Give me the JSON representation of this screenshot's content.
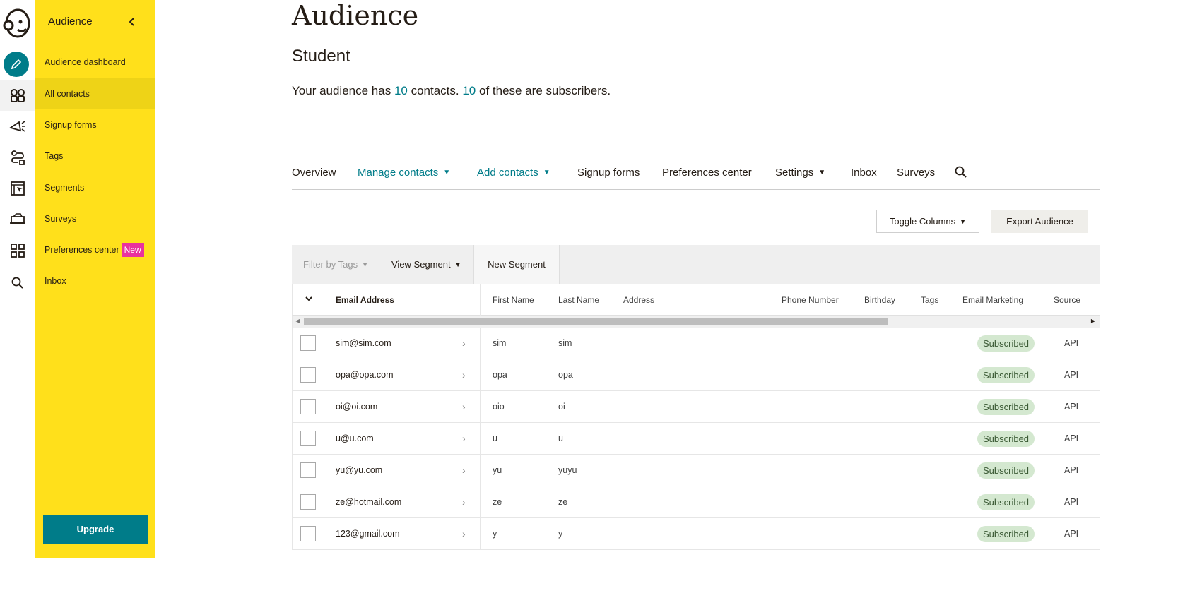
{
  "nav": {
    "title": "Audience",
    "items": [
      {
        "label": "Audience dashboard"
      },
      {
        "label": "All contacts"
      },
      {
        "label": "Signup forms"
      },
      {
        "label": "Tags"
      },
      {
        "label": "Segments"
      },
      {
        "label": "Surveys"
      },
      {
        "label": "Preferences center",
        "badge": "New"
      },
      {
        "label": "Inbox"
      }
    ],
    "upgrade_label": "Upgrade"
  },
  "page": {
    "title": "Audience",
    "subtitle": "Student",
    "summary_prefix": "Your audience has ",
    "contacts_count": "10",
    "summary_mid": " contacts. ",
    "subscribers_count": "10",
    "summary_suffix": " of these are subscribers."
  },
  "tabs": [
    {
      "label": "Overview"
    },
    {
      "label": "Manage contacts"
    },
    {
      "label": "Add contacts"
    },
    {
      "label": "Signup forms"
    },
    {
      "label": "Preferences center"
    },
    {
      "label": "Settings"
    },
    {
      "label": "Inbox"
    },
    {
      "label": "Surveys"
    }
  ],
  "actions": {
    "toggle_columns": "Toggle Columns",
    "export_audience": "Export Audience"
  },
  "filters": {
    "filter_by_tags": "Filter by Tags",
    "view_segment": "View Segment",
    "new_segment": "New Segment"
  },
  "table": {
    "columns": [
      "Email Address",
      "First Name",
      "Last Name",
      "Address",
      "Phone Number",
      "Birthday",
      "Tags",
      "Email Marketing",
      "Source"
    ],
    "rows": [
      {
        "email": "sim@sim.com",
        "first": "sim",
        "last": "sim",
        "status": "Subscribed",
        "source": "API"
      },
      {
        "email": "opa@opa.com",
        "first": "opa",
        "last": "opa",
        "status": "Subscribed",
        "source": "API"
      },
      {
        "email": "oi@oi.com",
        "first": "oio",
        "last": "oi",
        "status": "Subscribed",
        "source": "API"
      },
      {
        "email": "u@u.com",
        "first": "u",
        "last": "u",
        "status": "Subscribed",
        "source": "API"
      },
      {
        "email": "yu@yu.com",
        "first": "yu",
        "last": "yuyu",
        "status": "Subscribed",
        "source": "API"
      },
      {
        "email": "ze@hotmail.com",
        "first": "ze",
        "last": "ze",
        "status": "Subscribed",
        "source": "API"
      },
      {
        "email": "123@gmail.com",
        "first": "y",
        "last": "y",
        "status": "Subscribed",
        "source": "API"
      }
    ]
  },
  "colors": {
    "accent": "#007c89",
    "nav_bg": "#ffe01b",
    "badge_new": "#e9329e",
    "subscribed_bg": "#d4e8d0"
  }
}
